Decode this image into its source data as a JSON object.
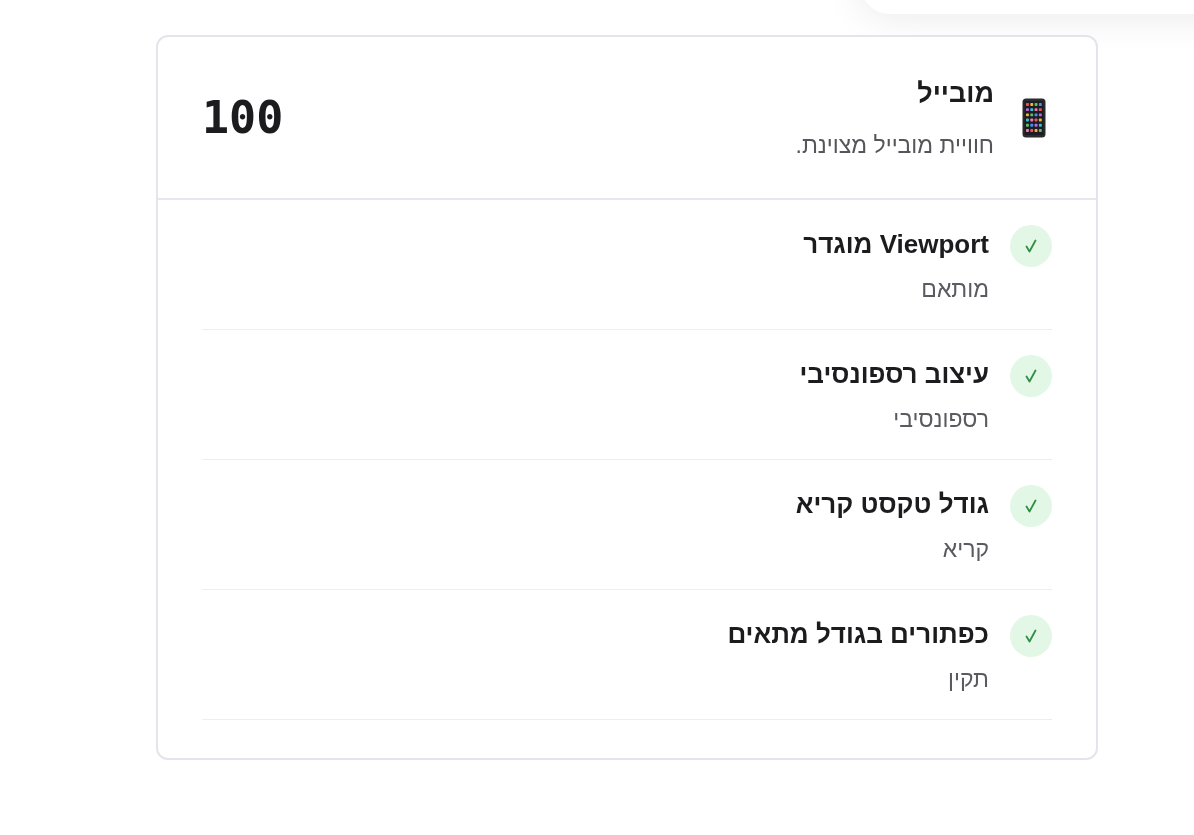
{
  "category": {
    "title": "מובייל",
    "description": "חוויית מובייל מצוינת.",
    "score": "100"
  },
  "checks": [
    {
      "title": "Viewport מוגדר",
      "detail": "מותאם",
      "passed": true
    },
    {
      "title": "עיצוב רספונסיבי",
      "detail": "רספונסיבי",
      "passed": true
    },
    {
      "title": "גודל טקסט קריא",
      "detail": "קריא",
      "passed": true
    },
    {
      "title": "כפתורים בגודל מתאים",
      "detail": "תקין",
      "passed": true
    }
  ]
}
